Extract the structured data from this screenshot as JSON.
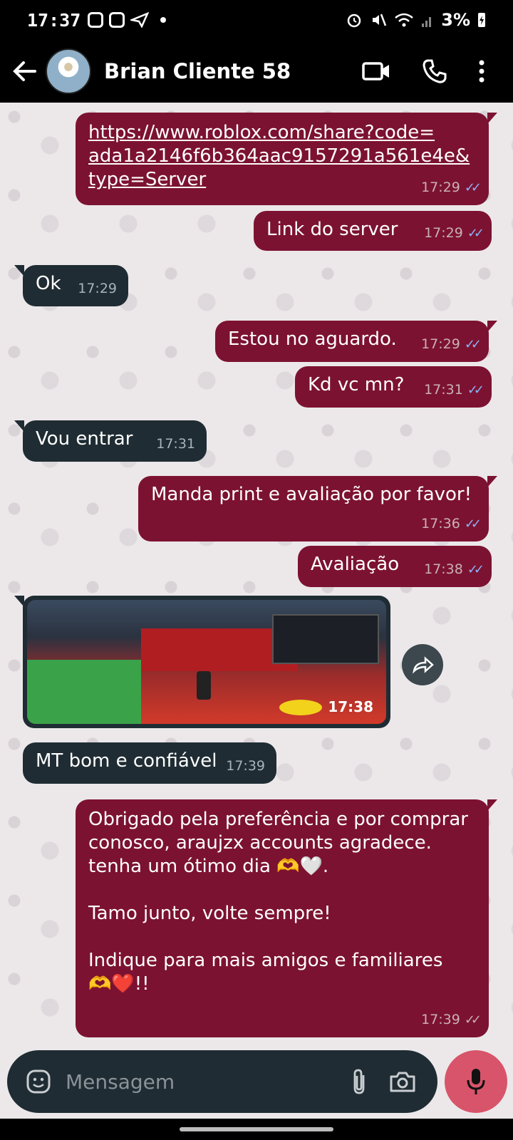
{
  "status_bar": {
    "time": "17:37",
    "battery": "3%"
  },
  "header": {
    "contact_name": "Brian Cliente 58"
  },
  "messages": [
    {
      "dir": "out",
      "text": "https://www.roblox.com/share?code=ada1a2146f6b364aac9157291a561e4e&type=Server",
      "time": "17:29",
      "status": "read"
    },
    {
      "dir": "out",
      "text": "Link do server",
      "time": "17:29",
      "status": "read"
    },
    {
      "dir": "in",
      "text": "Ok",
      "time": "17:29"
    },
    {
      "dir": "out",
      "text": "Estou no aguardo.",
      "time": "17:29",
      "status": "read"
    },
    {
      "dir": "out",
      "text": "Kd vc mn?",
      "time": "17:31",
      "status": "read"
    },
    {
      "dir": "in",
      "text": "Vou entrar",
      "time": "17:31"
    },
    {
      "dir": "out",
      "text": "Manda print e avaliação por favor!",
      "time": "17:36",
      "status": "read"
    },
    {
      "dir": "out",
      "text": "Avaliação",
      "time": "17:38",
      "status": "read"
    },
    {
      "dir": "in",
      "type": "image",
      "time": "17:38"
    },
    {
      "dir": "in",
      "text": "MT bom e confiável",
      "time": "17:39"
    },
    {
      "dir": "out",
      "text_lines": [
        "Obrigado pela preferência e por comprar",
        "conosco, araujzx accounts agradece.",
        "tenha um ótimo dia 🫶🤍.",
        "",
        "Tamo junto, volte sempre!",
        "",
        "Indique para mais amigos e familiares",
        "🫶❤️!!"
      ],
      "time": "17:39",
      "status": "delivered"
    }
  ],
  "link_lines": [
    "https://www.roblox.com/share?code=",
    "ada1a2146f6b364aac9157291a561e4e&",
    "type=Server"
  ],
  "input": {
    "placeholder": "Mensagem"
  },
  "colors": {
    "outgoing_bubble": "#7c1231",
    "incoming_bubble": "#1f2c33",
    "mic_button": "#d8546a",
    "read_ticks": "#8ab4f8"
  }
}
